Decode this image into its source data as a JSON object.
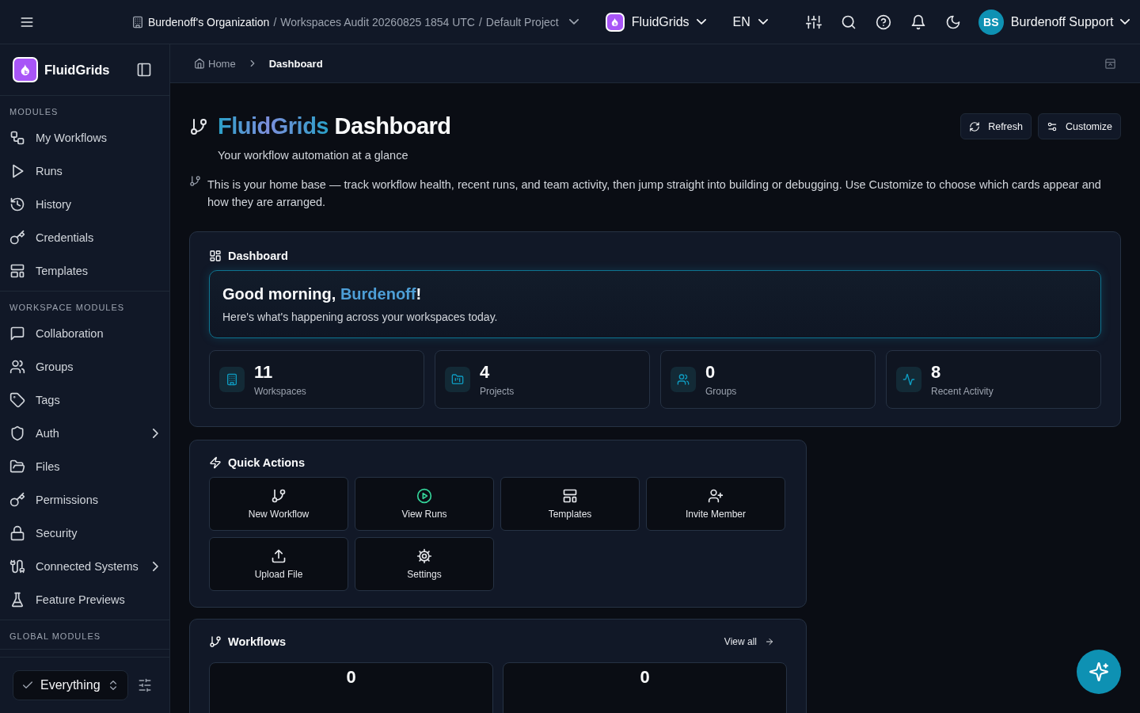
{
  "topbar": {
    "separator": "/",
    "path": [
      "Burdenoff's Organization",
      "Workspaces Audit 20260825 1854 UTC",
      "Default Project"
    ],
    "app": "FluidGrids",
    "language": "EN",
    "user": {
      "initials": "BS",
      "name": "Burdenoff Support"
    }
  },
  "sidebar": {
    "brand": "FluidGrids",
    "sections": [
      {
        "title": "MODULES",
        "items": [
          {
            "label": "My Workflows",
            "expandable": false
          },
          {
            "label": "Runs",
            "expandable": false
          },
          {
            "label": "History",
            "expandable": false
          },
          {
            "label": "Credentials",
            "expandable": false
          },
          {
            "label": "Templates",
            "expandable": false
          }
        ]
      },
      {
        "title": "WORKSPACE MODULES",
        "items": [
          {
            "label": "Collaboration",
            "expandable": false
          },
          {
            "label": "Groups",
            "expandable": false
          },
          {
            "label": "Tags",
            "expandable": false
          },
          {
            "label": "Auth",
            "expandable": true
          },
          {
            "label": "Files",
            "expandable": false
          },
          {
            "label": "Permissions",
            "expandable": false
          },
          {
            "label": "Security",
            "expandable": false
          },
          {
            "label": "Connected Systems",
            "expandable": true
          },
          {
            "label": "Feature Previews",
            "expandable": false
          }
        ]
      },
      {
        "title": "GLOBAL MODULES"
      }
    ],
    "filter": {
      "value": "Everything"
    }
  },
  "breadcrumb": [
    {
      "label": "Home",
      "current": false
    },
    {
      "label": "Dashboard",
      "current": true
    }
  ],
  "header": {
    "title_accent": "FluidGrids",
    "title": "Dashboard",
    "subtitle": "Your workflow automation at a glance",
    "description": "This is your home base — track workflow health, recent runs, and team activity, then jump straight into building or debugging. Use Customize to choose which cards appear and how they are arranged.",
    "buttons": [
      "Refresh",
      "Customize"
    ]
  },
  "dashboard": {
    "title": "Dashboard",
    "greeting": "Good morning, ",
    "name": "Burdenoff",
    "greeting_end": "!",
    "message": "Here's what's happening across your workspaces today.",
    "stats": [
      {
        "value": "11",
        "label": "Workspaces"
      },
      {
        "value": "4",
        "label": "Projects"
      },
      {
        "value": "0",
        "label": "Groups"
      },
      {
        "value": "8",
        "label": "Recent Activity"
      }
    ]
  },
  "quick_actions": {
    "title": "Quick Actions",
    "actions": [
      "New Workflow",
      "View Runs",
      "Templates",
      "Invite Member",
      "Upload File",
      "Settings"
    ]
  },
  "workflows": {
    "title": "Workflows",
    "view_all": "View all",
    "tiles": [
      {
        "value": "0"
      },
      {
        "value": "0"
      }
    ]
  }
}
